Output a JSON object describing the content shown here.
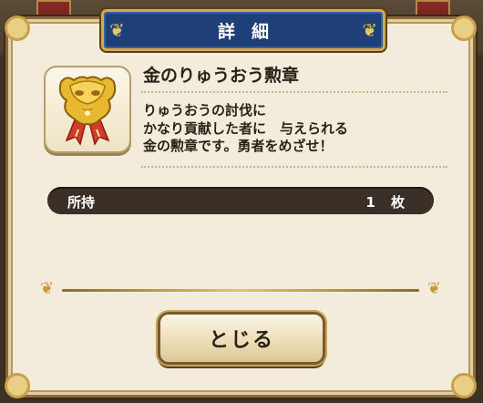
{
  "dialog": {
    "title": "詳細",
    "title_ornament": "❦",
    "close_label": "とじる"
  },
  "item": {
    "name": "金のりゅうおう勲章",
    "description": "りゅうおうの討伐に\nかなり貢献した者に　与えられる\n金の勲章です。勇者をめざせ！",
    "icon": "gold-dragonlord-medal-icon"
  },
  "possession": {
    "label": "所持",
    "count": "1 枚"
  },
  "colors": {
    "panel": "#f3ecdc",
    "title_plate": "#1f3f78",
    "gold_trim": "#d2a94e",
    "possession_bar": "#3a3028"
  }
}
